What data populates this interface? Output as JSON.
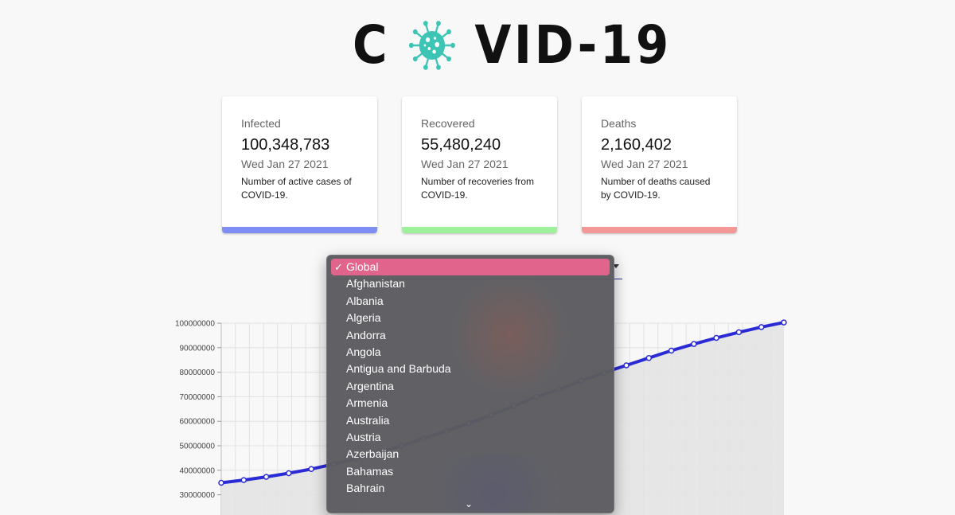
{
  "logo": {
    "left": "C",
    "right": "VID-19",
    "virus_color": "#3cc4b4"
  },
  "cards": [
    {
      "label": "Infected",
      "value": "100,348,783",
      "date": "Wed Jan 27 2021",
      "description": "Number of active cases of COVID-19.",
      "bar_color": "#7f8ef2"
    },
    {
      "label": "Recovered",
      "value": "55,480,240",
      "date": "Wed Jan 27 2021",
      "description": "Number of recoveries from COVID-19.",
      "bar_color": "#9ef09a"
    },
    {
      "label": "Deaths",
      "value": "2,160,402",
      "date": "Wed Jan 27 2021",
      "description": "Number of deaths caused by COVID-19.",
      "bar_color": "#f49796"
    }
  ],
  "country_select": {
    "selected": "Global",
    "options": [
      "Global",
      "Afghanistan",
      "Albania",
      "Algeria",
      "Andorra",
      "Angola",
      "Antigua and Barbuda",
      "Argentina",
      "Armenia",
      "Australia",
      "Austria",
      "Azerbaijan",
      "Bahamas",
      "Bahrain"
    ],
    "check_icon": "checkmark-icon",
    "more_icon": "chevron-down-icon",
    "highlight_color": "#e0648c"
  },
  "chart_data": {
    "type": "line",
    "title": "",
    "xlabel": "",
    "ylabel": "",
    "line_color": "#2b2bd6",
    "fill_color": "#e3e3e3",
    "y_ticks": [
      100000000,
      90000000,
      80000000,
      70000000,
      60000000,
      50000000,
      40000000,
      30000000
    ],
    "ylim": [
      25000000,
      100000000
    ],
    "grid": true,
    "series": [
      {
        "x": [
          0.0,
          0.04,
          0.08,
          0.12,
          0.16,
          0.2,
          0.24,
          0.28,
          0.32,
          0.36,
          0.4,
          0.44,
          0.48,
          0.52,
          0.56,
          0.6,
          0.64,
          0.68,
          0.72,
          0.76,
          0.8,
          0.84,
          0.88,
          0.92,
          0.96,
          1.0
        ],
        "values": [
          34900000,
          36000000,
          37300000,
          38800000,
          40500000,
          42500000,
          44800000,
          47300000,
          50000000,
          53000000,
          56000000,
          59200000,
          62600000,
          66200000,
          70000000,
          73000000,
          76500000,
          79800000,
          82800000,
          85800000,
          88800000,
          91500000,
          94000000,
          96300000,
          98400000,
          100300000
        ]
      }
    ]
  }
}
